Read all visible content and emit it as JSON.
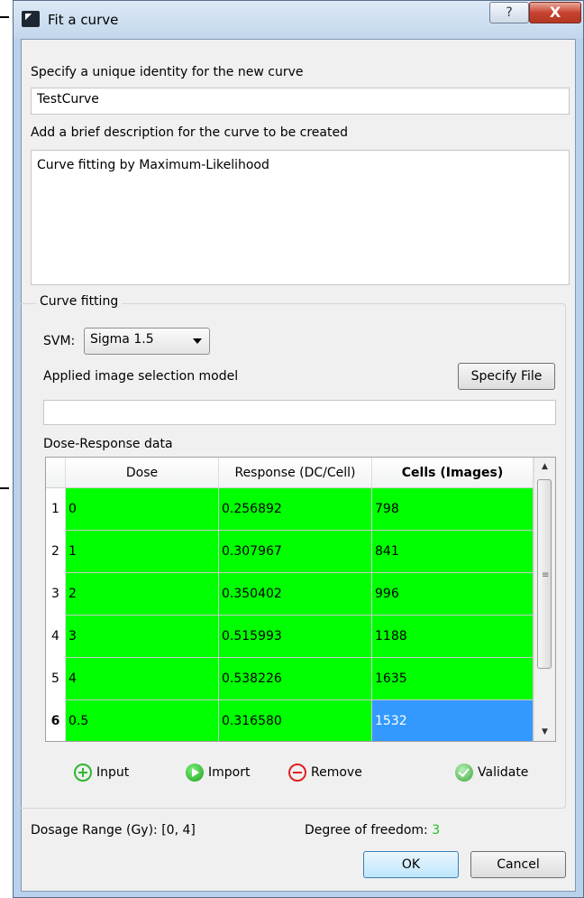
{
  "window": {
    "title": "Fit a curve",
    "help_label": "?",
    "close_label": "X"
  },
  "identity": {
    "label": "Specify a unique identity for the new curve",
    "value": "TestCurve"
  },
  "description": {
    "label": "Add a brief description for the curve to be created",
    "value": "Curve fitting by Maximum-Likelihood"
  },
  "curve_fitting": {
    "group_title": "Curve fitting",
    "svm_label": "SVM:",
    "svm_value": "Sigma 1.5",
    "model_label": "Applied image selection model",
    "specify_file_label": "Specify File",
    "model_value": "",
    "dose_response_label": "Dose-Response data"
  },
  "table": {
    "columns": [
      "Dose",
      "Response (DC/Cell)",
      "Cells (Images)"
    ],
    "rows": [
      {
        "num": "1",
        "dose": "0",
        "response": "0.256892",
        "cells": "798"
      },
      {
        "num": "2",
        "dose": "1",
        "response": "0.307967",
        "cells": "841"
      },
      {
        "num": "3",
        "dose": "2",
        "response": "0.350402",
        "cells": "996"
      },
      {
        "num": "4",
        "dose": "3",
        "response": "0.515993",
        "cells": "1188"
      },
      {
        "num": "5",
        "dose": "4",
        "response": "0.538226",
        "cells": "1635"
      },
      {
        "num": "6",
        "dose": "0.5",
        "response": "0.316580",
        "cells": "1532"
      }
    ]
  },
  "actions": {
    "input": "Input",
    "import": "Import",
    "remove": "Remove",
    "validate": "Validate"
  },
  "footer": {
    "dosage_range": "Dosage Range (Gy): [0, 4]",
    "dof_label": "Degree of freedom:",
    "dof_value": "3",
    "ok_label": "OK",
    "cancel_label": "Cancel"
  },
  "colors": {
    "cell_green": "#00ff00",
    "selected_blue": "#3399ff",
    "dof_green": "#22c022"
  }
}
